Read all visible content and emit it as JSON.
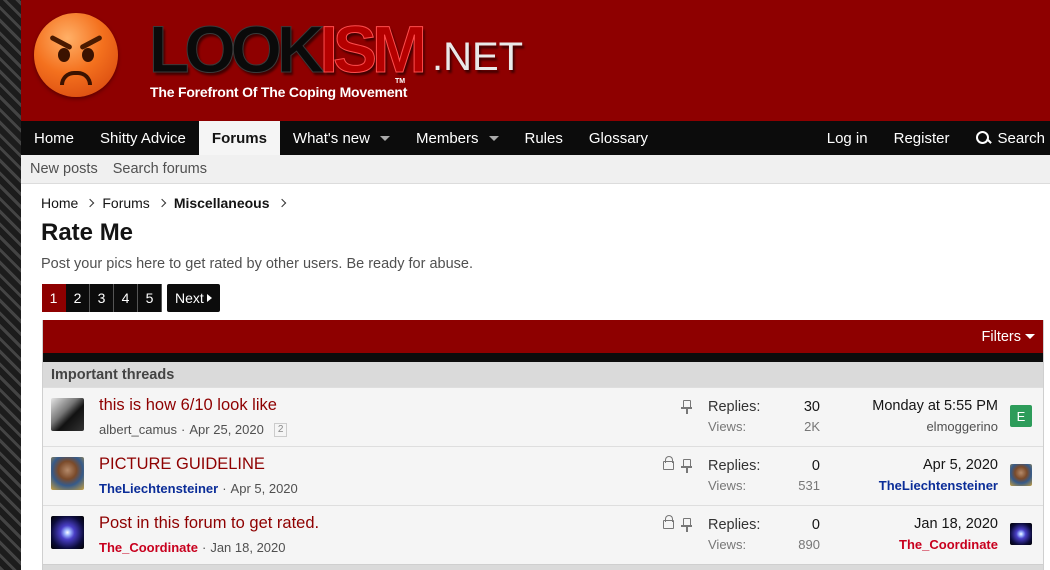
{
  "logo": {
    "part1": "LOOK",
    "part2": "ISM",
    "part3": ".NET",
    "tagline": "The Forefront Of The Coping Movement",
    "tm": "TM"
  },
  "nav": {
    "items": [
      "Home",
      "Shitty Advice",
      "Forums",
      "What's new",
      "Members",
      "Rules",
      "Glossary"
    ],
    "right": [
      "Log in",
      "Register",
      "Search"
    ]
  },
  "subnav": [
    "New posts",
    "Search forums"
  ],
  "breadcrumb": [
    "Home",
    "Forums",
    "Miscellaneous"
  ],
  "page": {
    "title": "Rate Me",
    "description": "Post your pics here to get rated by other users. Be ready for abuse."
  },
  "pagination": {
    "pages": [
      "1",
      "2",
      "3",
      "4",
      "5"
    ],
    "current": "1",
    "next": "Next"
  },
  "filters": "Filters",
  "section": "Important threads",
  "stat_labels": {
    "replies": "Replies:",
    "views": "Views:"
  },
  "threads": [
    {
      "title": "this is how 6/10 look like",
      "author": "albert_camus",
      "date": "Apr 25, 2020",
      "pages": "2",
      "replies": "30",
      "views": "2K",
      "last_date": "Monday at 5:55 PM",
      "last_user": "elmoggerino",
      "last_avatar_letter": "E"
    },
    {
      "title": "PICTURE GUIDELINE",
      "author": "TheLiechtensteiner",
      "date": "Apr 5, 2020",
      "replies": "0",
      "views": "531",
      "last_date": "Apr 5, 2020",
      "last_user": "TheLiechtensteiner"
    },
    {
      "title": "Post in this forum to get rated.",
      "author": "The_Coordinate",
      "date": "Jan 18, 2020",
      "replies": "0",
      "views": "890",
      "last_date": "Jan 18, 2020",
      "last_user": "The_Coordinate"
    }
  ],
  "colors": {
    "brand": "#8e0000",
    "nav": "#0c0c0c",
    "link_blue": "#0b2d98",
    "link_red": "#c8001e",
    "avatar_e": "#2d9c5a"
  }
}
